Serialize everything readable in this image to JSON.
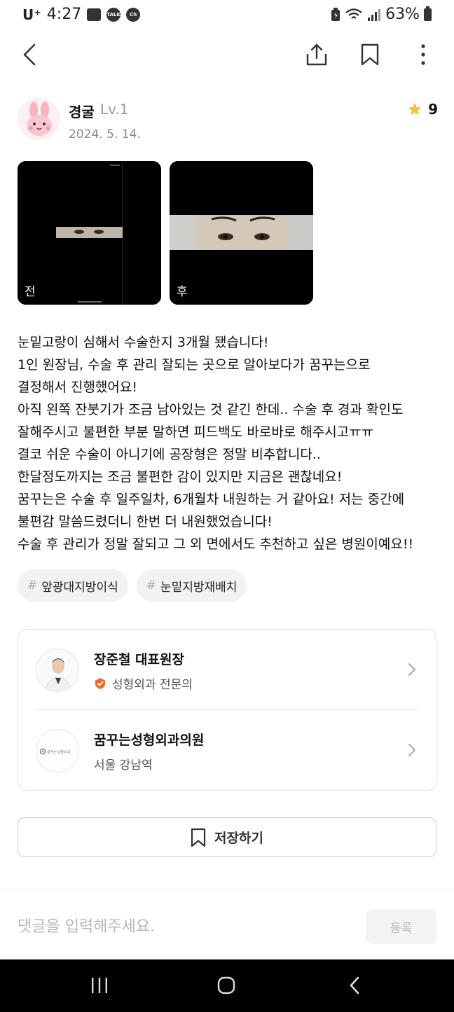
{
  "status_bar": {
    "carrier": "U⁺",
    "time": "4:27",
    "noti_talk": "TALK",
    "noti_ch": "Ch",
    "battery_percent": "63%"
  },
  "review": {
    "author_name": "경굴",
    "author_level": "Lv.1",
    "date": "2024. 5. 14.",
    "likes": "9",
    "photos": [
      {
        "label": "전"
      },
      {
        "label": "후"
      }
    ],
    "body_lines": [
      "눈밑고랑이 심해서 수술한지 3개월 됐습니다!",
      "1인 원장님, 수술 후 관리 잘되는 곳으로 알아보다가 꿈꾸는으로",
      "결정해서 진행했어요!",
      "아직 왼쪽 잔붓기가 조금 남아있는 것 같긴 한데.. 수술 후 경과 확인도",
      "잘해주시고 불편한 부분 말하면 피드백도 바로바로 해주시고ㅠㅠ",
      "결코 쉬운 수술이 아니기에 공장형은 정말 비추합니다..",
      "한달정도까지는 조금 불편한 감이 있지만 지금은 괜찮네요!",
      "꿈꾸는은 수술 후 일주일차, 6개월차 내원하는 거 같아요! 저는 중간에",
      "불편감 말씀드렸더니 한번 더 내원했었습니다!",
      "수술 후 관리가 정말 잘되고 그 외 면에서도 추천하고 싶은 병원이예요!!"
    ],
    "hashtags": [
      "앞광대지방이식",
      "눈밑지방재배치"
    ]
  },
  "doctor": {
    "name": "장준철 대표원장",
    "specialty": "성형외과 전문의"
  },
  "clinic": {
    "name": "꿈꾸는성형외과의원",
    "location": "서울 강남역",
    "logo_text": "꿈꾸는성형외과"
  },
  "save_label": "저장하기",
  "comment": {
    "placeholder": "댓글을 입력해주세요.",
    "submit_label": "등록"
  },
  "colors": {
    "star": "#f8c531",
    "badge": "#f06a24",
    "muted_text": "#888888"
  }
}
